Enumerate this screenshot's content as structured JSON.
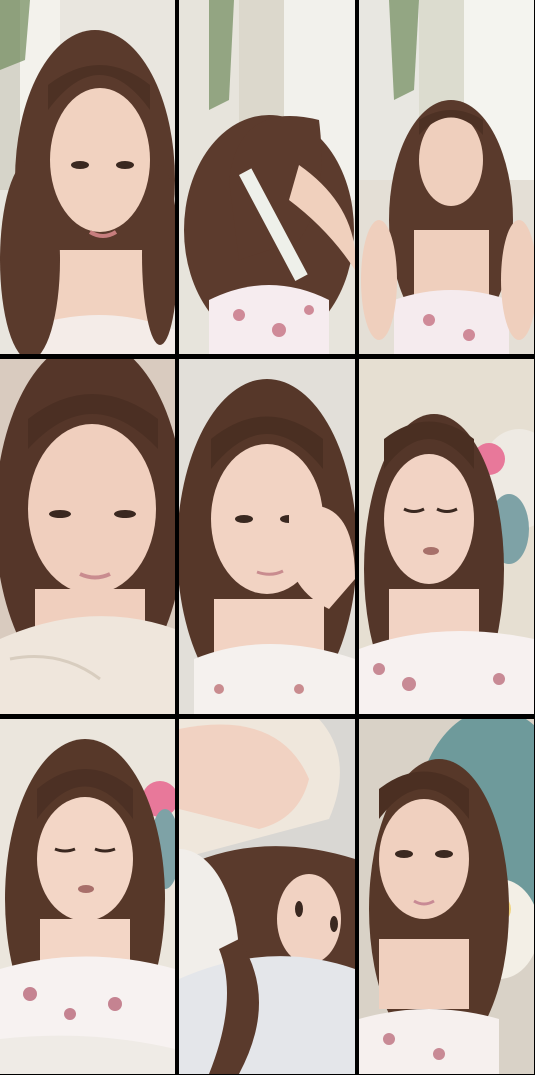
{
  "grid": {
    "rows": 3,
    "columns": 3,
    "tiles": [
      {
        "scene": "window-background-close-face",
        "bg": "#e9e6df",
        "hair": "#5a3a2c",
        "skin": "#f1d2c0",
        "top": "#f4ece8",
        "accent": "#c88a8f"
      },
      {
        "scene": "combing-hair-with-window",
        "bg": "#e7e4dc",
        "hair": "#5c3b2d",
        "skin": "#f0d0bd",
        "top": "#f6ecef",
        "accent": "#cf8a98"
      },
      {
        "scene": "window-background-full-upper-body",
        "bg": "#e8e7e1",
        "hair": "#5a3a2c",
        "skin": "#efcfbd",
        "top": "#f5ebee",
        "accent": "#cf8a98"
      },
      {
        "scene": "in-bed-close-face",
        "bg": "#d9cbbf",
        "hair": "#553629",
        "skin": "#f0cfbe",
        "top": "#efe6dc",
        "accent": "#c98c8f"
      },
      {
        "scene": "in-bed-hand-on-cheek",
        "bg": "#e2dfd9",
        "hair": "#563729",
        "skin": "#f2d3c3",
        "top": "#f5f1ee",
        "accent": "#c98c8f"
      },
      {
        "scene": "eyes-closed-plush-background",
        "bg": "#e6dfd2",
        "hair": "#543629",
        "skin": "#f2d3c4",
        "top": "#f7f1f0",
        "accent": "#c88a95"
      },
      {
        "scene": "bed-speaking-plush-side",
        "bg": "#ebe6dd",
        "hair": "#573829",
        "skin": "#f3d6c6",
        "top": "#f7f2f1",
        "accent": "#c58391"
      },
      {
        "scene": "lying-down-arm-over-pillow",
        "bg": "#d9d7d3",
        "hair": "#5a3a2c",
        "skin": "#f1d2c2",
        "top": "#f1eeea",
        "accent": "#c88a95"
      },
      {
        "scene": "with-teal-plush-toy",
        "bg": "#d9d2c7",
        "hair": "#573829",
        "skin": "#f0d0bf",
        "top": "#f6f0ee",
        "accent": "#c88a95"
      }
    ]
  }
}
